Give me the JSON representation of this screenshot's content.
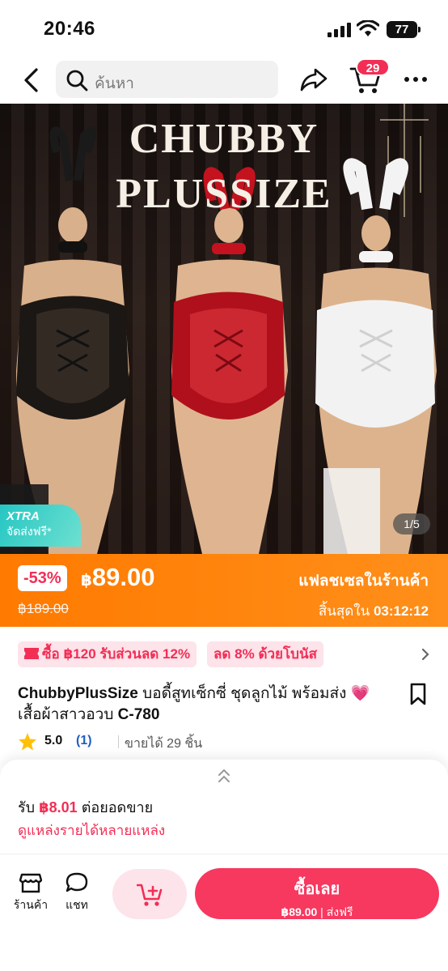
{
  "status_bar": {
    "time": "20:46",
    "battery": "77"
  },
  "nav": {
    "search_placeholder": "ค้นหา",
    "cart_count": "29"
  },
  "hero": {
    "title_line1": "CHUBBY",
    "title_line2": "PLUSSIZE",
    "xtra_label": "XTRA",
    "xtra_sub": "จัดส่งฟรี*",
    "pager": "1/5"
  },
  "flash": {
    "discount": "-53%",
    "currency": "฿",
    "price": "89.00",
    "original_price": "฿189.00",
    "label": "แฟลชเซลในร้านค้า",
    "ends_prefix": "สิ้นสุดใน",
    "countdown": "03:12:12"
  },
  "promos": {
    "chip1": "ซื้อ ฿120 รับส่วนลด 12%",
    "chip2": "ลด 8% ด้วยโบนัส"
  },
  "product": {
    "brand": "ChubbyPlusSize",
    "title": "บอดี้สูทเซ็กซี่ ชุดลูกไม้ พร้อมส่ง 💗 เสื้อผ้าสาวอวบ",
    "code": "C-780",
    "rating": "5.0",
    "review_count": "(1)",
    "sold": "ขายได้ 29 ชิ้น"
  },
  "sheet": {
    "earn_prefix": "รับ",
    "earn_amount": "฿8.01",
    "earn_suffix": "ต่อยอดขาย",
    "link": "ดูแหล่งรายได้หลายแหล่ง"
  },
  "bottom": {
    "shop_label": "ร้านค้า",
    "chat_label": "แชท",
    "buy_label": "ซื้อเลย",
    "buy_price": "฿89.00",
    "buy_shipping": "ส่งฟรี"
  },
  "colors": {
    "accent": "#f22e55",
    "flash_bg": "#ff7a00",
    "buy_bg": "#f7385f"
  }
}
